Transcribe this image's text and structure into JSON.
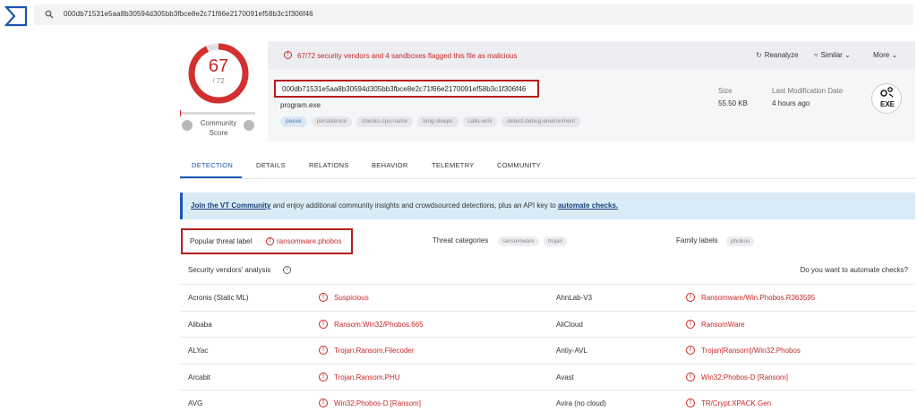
{
  "search": {
    "query": "000db71531e5aa8b30594d305bb3fbce8e2c71f66e2170091ef58b3c1f306f46"
  },
  "score": {
    "detected": "67",
    "total": "/ 72",
    "community_label": "Community Score",
    "fraction": 0.93
  },
  "alert": {
    "text": "67/72 security vendors and 4 sandboxes flagged this file as malicious"
  },
  "actions": {
    "reanalyze": "Reanalyze",
    "similar": "Similar",
    "more": "More"
  },
  "file": {
    "hash": "000db71531e5aa8b30594d305bb3fbce8e2c71f66e2170091ef58b3c1f306f46",
    "name": "program.exe",
    "tags": [
      "peexe",
      "persistence",
      "checks-cpu-name",
      "long-sleeps",
      "calls-wmi",
      "detect-debug-environment"
    ],
    "size_label": "Size",
    "size_value": "55.50 KB",
    "modified_label": "Last Modification Date",
    "modified_value": "4 hours ago",
    "type_badge": "EXE"
  },
  "tabs": [
    "DETECTION",
    "DETAILS",
    "RELATIONS",
    "BEHAVIOR",
    "TELEMETRY",
    "COMMUNITY"
  ],
  "banner": {
    "link1": "Join the VT Community",
    "middle": " and enjoy additional community insights and crowdsourced detections, plus an API key to ",
    "link2": "automate checks."
  },
  "threat": {
    "popular_label": "Popular threat label",
    "popular_value": "ransomware.phobos",
    "categories_label": "Threat categories",
    "categories": [
      "ransomware",
      "trojan"
    ],
    "family_label": "Family labels",
    "families": [
      "phobos"
    ]
  },
  "analysis": {
    "title": "Security vendors' analysis",
    "automate_question": "Do you want to automate checks?"
  },
  "vendors": [
    {
      "left_name": "Acronis (Static ML)",
      "left_result": "Suspicious",
      "right_name": "AhnLab-V3",
      "right_result": "Ransomware/Win.Phobos.R363595"
    },
    {
      "left_name": "Alibaba",
      "left_result": "Ransom:Win32/Phobos.665",
      "right_name": "AliCloud",
      "right_result": "RansomWare"
    },
    {
      "left_name": "ALYac",
      "left_result": "Trojan.Ransom.Filecoder",
      "right_name": "Antiy-AVL",
      "right_result": "Trojan[Ransom]/Win32.Phobos"
    },
    {
      "left_name": "Arcabit",
      "left_result": "Trojan.Ransom.PHU",
      "right_name": "Avast",
      "right_result": "Win32:Phobos-D [Ransom]"
    },
    {
      "left_name": "AVG",
      "left_result": "Win32:Phobos-D [Ransom]",
      "right_name": "Avira (no cloud)",
      "right_result": "TR/Crypt.XPACK.Gen"
    }
  ],
  "colors": {
    "malicious": "#c62828",
    "accent": "#1a56b4",
    "banner_bg": "#d9ecf6"
  }
}
